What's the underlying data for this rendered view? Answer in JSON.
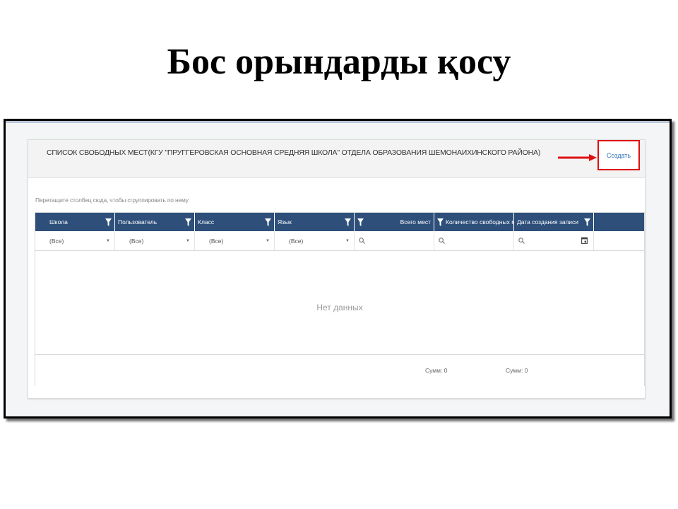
{
  "slide": {
    "title": "Бос орындарды қосу"
  },
  "panel": {
    "title": "СПИСОК СВОБОДНЫХ МЕСТ(КГУ \"ПРУГГЕРОВСКАЯ ОСНОВНАЯ СРЕДНЯЯ ШКОЛА\" ОТДЕЛА ОБРАЗОВАНИЯ ШЕМОНАИХИНСКОГО РАЙОНА)",
    "create_label": "Создать",
    "group_hint": "Перетащите столбец сюда, чтобы сгруппировать по нему"
  },
  "grid": {
    "columns": [
      {
        "label": "Школа",
        "filter": "(Все)",
        "filter_type": "select"
      },
      {
        "label": "Пользователь",
        "filter": "(Все)",
        "filter_type": "select"
      },
      {
        "label": "Класс",
        "filter": "(Все)",
        "filter_type": "select"
      },
      {
        "label": "Язык",
        "filter": "(Все)",
        "filter_type": "select"
      },
      {
        "label": "Всего мест",
        "filter": "",
        "filter_type": "search"
      },
      {
        "label": "Количество свободных мест",
        "filter": "",
        "filter_type": "search"
      },
      {
        "label": "Дата создания записи",
        "filter": "",
        "filter_type": "date"
      }
    ],
    "empty_text": "Нет данных",
    "footer": {
      "sum_total": "Сумм: 0",
      "sum_free": "Сумм: 0"
    }
  },
  "colors": {
    "header_bg": "#2d4f7a",
    "highlight_red": "#e01010",
    "link_blue": "#2f6fb5"
  },
  "icons": [
    "filter-funnel-icon",
    "search-icon",
    "calendar-icon",
    "dropdown-caret-icon",
    "red-arrow-icon"
  ]
}
